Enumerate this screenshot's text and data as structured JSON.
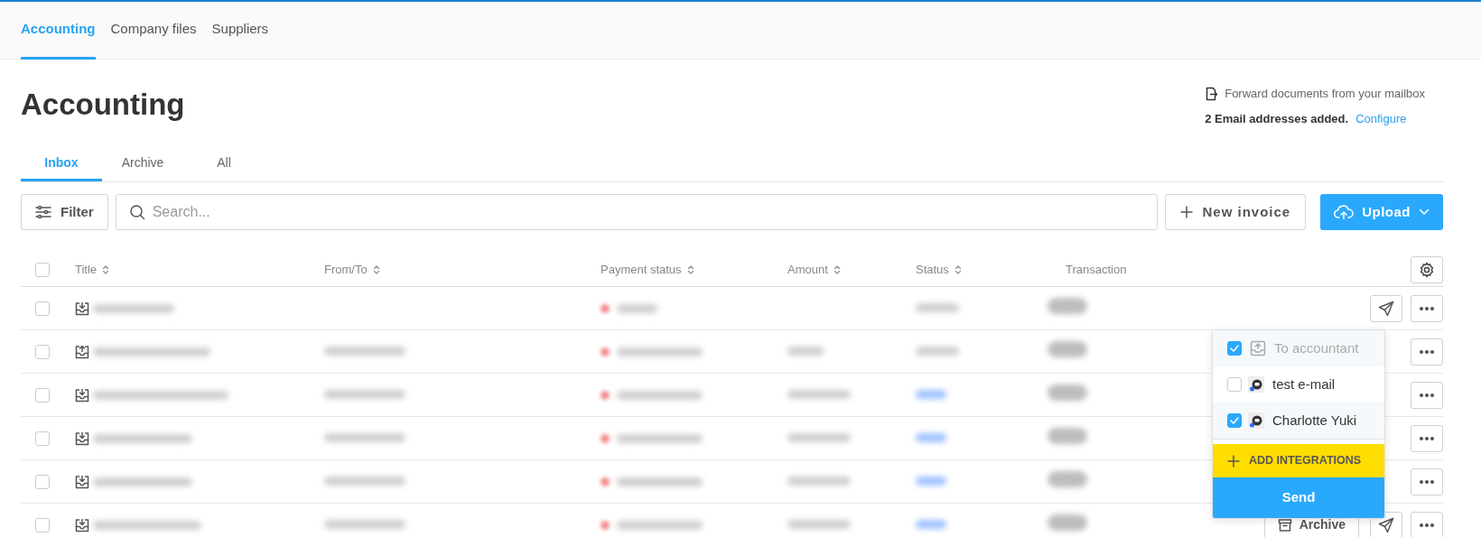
{
  "top_nav": [
    {
      "label": "Accounting",
      "selected": true
    },
    {
      "label": "Company files",
      "selected": false
    },
    {
      "label": "Suppliers",
      "selected": false
    }
  ],
  "page_title": "Accounting",
  "mailbox": {
    "text": "Forward documents from your mailbox",
    "summary": "2 Email addresses added.",
    "link": "Configure"
  },
  "tabs": [
    {
      "label": "Inbox",
      "selected": true
    },
    {
      "label": "Archive",
      "selected": false
    },
    {
      "label": "All",
      "selected": false
    }
  ],
  "toolbar": {
    "filter": "Filter",
    "search": {
      "placeholder": "Search..."
    },
    "new_invoice": "New invoice",
    "upload": "Upload"
  },
  "table": {
    "select_all": {
      "checked": false
    },
    "columns": [
      {
        "label": "Title",
        "sortable": true
      },
      {
        "label": "From/To",
        "sortable": true
      },
      {
        "label": "Payment status",
        "sortable": true
      },
      {
        "label": "Amount",
        "sortable": true
      },
      {
        "label": "Status",
        "sortable": true
      },
      {
        "label": "Transaction",
        "sortable": false
      }
    ],
    "rows": [
      {
        "kind": "incoming",
        "checked": false,
        "has_from": false,
        "has_amount": false,
        "color": "#cfcfcf",
        "actions": [
          {
            "kind": "send"
          },
          {
            "kind": "more"
          }
        ]
      },
      {
        "kind": "outgoing",
        "checked": false,
        "has_from": true,
        "has_amount": true,
        "color": "#cfcfcf",
        "actions": [
          {
            "kind": "more"
          }
        ]
      },
      {
        "kind": "incoming",
        "checked": false,
        "has_from": true,
        "has_amount": true,
        "color": "#9fc3ff",
        "actions": [
          {
            "kind": "more"
          }
        ]
      },
      {
        "kind": "incoming",
        "checked": false,
        "has_from": true,
        "has_amount": true,
        "color": "#9fc3ff",
        "actions": [
          {
            "kind": "more"
          }
        ]
      },
      {
        "kind": "incoming",
        "checked": false,
        "has_from": true,
        "has_amount": true,
        "color": "#9fc3ff",
        "actions": [
          {
            "kind": "more"
          }
        ]
      },
      {
        "kind": "incoming",
        "checked": false,
        "has_from": true,
        "has_amount": true,
        "color": "#9fc3ff",
        "actions": [
          {
            "kind": "archive",
            "label": "Archive"
          },
          {
            "kind": "send"
          },
          {
            "kind": "more"
          }
        ]
      }
    ]
  },
  "send_menu": {
    "items": [
      {
        "kind": "accountant",
        "label": "To accountant",
        "checked": true,
        "disabled": true
      },
      {
        "kind": "integration",
        "label": "test e-mail",
        "checked": false,
        "disabled": false
      },
      {
        "kind": "integration",
        "label": "Charlotte Yuki",
        "checked": true,
        "disabled": false
      }
    ],
    "add": "ADD INTEGRATIONS",
    "send": "Send"
  }
}
